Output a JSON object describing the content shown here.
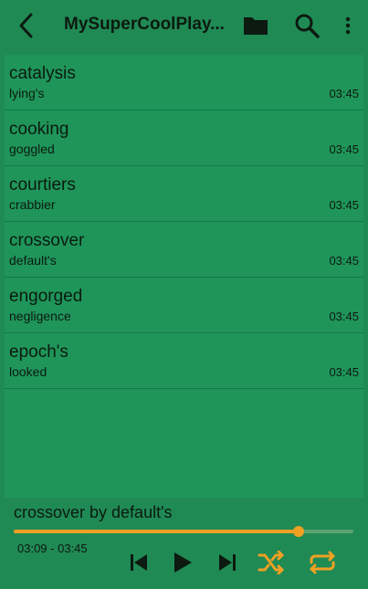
{
  "header": {
    "title": "MySuperCoolPlay..."
  },
  "songs": [
    {
      "title": "catalysis",
      "artist": "lying's",
      "duration": "03:45"
    },
    {
      "title": "cooking",
      "artist": "goggled",
      "duration": "03:45"
    },
    {
      "title": "courtiers",
      "artist": "crabbier",
      "duration": "03:45"
    },
    {
      "title": "crossover",
      "artist": "default's",
      "duration": "03:45"
    },
    {
      "title": "engorged",
      "artist": "negligence",
      "duration": "03:45"
    },
    {
      "title": "epoch's",
      "artist": "looked",
      "duration": "03:45"
    }
  ],
  "player": {
    "now_playing": "crossover by default's",
    "time_text": "03:09 - 03:45",
    "progress": 0.84,
    "accent_color": "#f0a023"
  },
  "icons": [
    "back-arrow-icon",
    "folder-icon",
    "search-icon",
    "more-vert-icon",
    "skip-previous-icon",
    "play-icon",
    "skip-next-icon",
    "shuffle-icon",
    "repeat-icon"
  ]
}
